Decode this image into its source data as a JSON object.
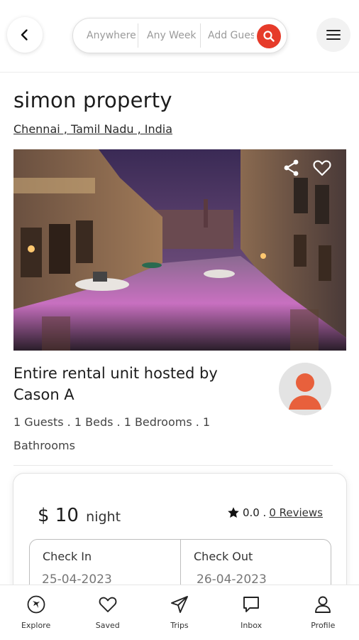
{
  "search": {
    "where": "Anywhere",
    "week": "Any Week",
    "guests": "Add Guests"
  },
  "header": {
    "title": "simon property",
    "location": "Chennai , Tamil Nadu , India"
  },
  "listing": {
    "heading": "Entire rental unit hosted by Cason A",
    "details": "1 Guests . 1 Beds . 1 Bedrooms . 1 Bathrooms"
  },
  "booking": {
    "price": "$ 10",
    "price_unit": "night",
    "rating": "0.0 .",
    "reviews": "0 Reviews",
    "check_in_label": "Check In",
    "check_in_value": "25-04-2023",
    "check_out_label": "Check Out",
    "check_out_value": "26-04-2023"
  },
  "nav": {
    "items": [
      {
        "label": "Explore",
        "icon": "explore-icon"
      },
      {
        "label": "Saved",
        "icon": "heart-icon"
      },
      {
        "label": "Trips",
        "icon": "send-icon"
      },
      {
        "label": "Inbox",
        "icon": "chat-icon"
      },
      {
        "label": "Profile",
        "icon": "user-icon"
      }
    ]
  },
  "colors": {
    "accent": "#e63b2a",
    "avatar": "#e8603c"
  }
}
